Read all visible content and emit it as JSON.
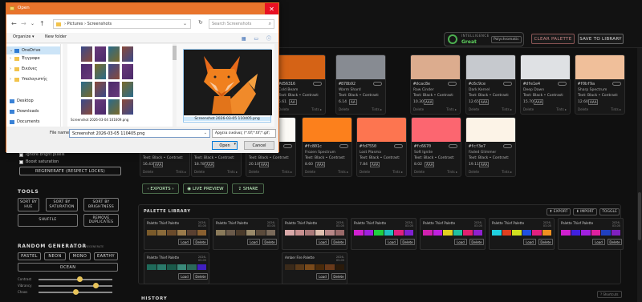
{
  "dialog": {
    "title": "Open",
    "close": "✕",
    "breadcrumb": "›  Pictures  ›  Screenshots",
    "search_placeholder": "Search Screenshots",
    "organize": "Organize ▾",
    "new_folder": "New folder",
    "nav_items": [
      {
        "label": "OneDrive",
        "color": "#2f7bd3"
      },
      {
        "label": "Έγγραφα",
        "color": "#f2c34c"
      },
      {
        "label": "Εικόνες",
        "color": "#f2c34c"
      },
      {
        "label": "Υπολογιστής",
        "color": "#f2c34c"
      },
      {
        "label": "Desktop",
        "color": "#3a82d6"
      },
      {
        "label": "Downloads",
        "color": "#3a82d6"
      },
      {
        "label": "Documents",
        "color": "#3a82d6"
      }
    ],
    "grid_files": [
      "Screenshot 2026-03-04 101609.png"
    ],
    "preview_caption": "Screenshot 2026-03-05 110405.png",
    "file_name_label": "File name:",
    "file_name_value": "Screenshot 2026-03-05 110405.png",
    "file_type": "Αρχεία εικόνας (*.tif;*.tif;*.gif;",
    "open": "Open",
    "cancel": "Cancel"
  },
  "header": {
    "intelligence_label": "INTELLIGENCE",
    "intelligence_value": "Great",
    "intelligence_chip": "Polychromatic",
    "clear_palette": "CLEAR PALETTE",
    "save_to_library": "SAVE TO LIBRARY"
  },
  "swatches": [
    {
      "hex": "#d56316",
      "color": "#d56316",
      "name": "Cold Beam",
      "contrast": "Text: Black • Contrast:",
      "ratio": "5.61",
      "aa": "AA"
    },
    {
      "hex": "#878b92",
      "color": "#878b92",
      "name": "Warm Shard",
      "contrast": "Text: Black • Contrast:",
      "ratio": "6.14",
      "aa": "AA"
    },
    {
      "hex": "#dcac8e",
      "color": "#dcac8e",
      "name": "Raw Cinder",
      "contrast": "Text: Black • Contrast:",
      "ratio": "10.30",
      "aa": "AAA"
    },
    {
      "hex": "#c6c9ce",
      "color": "#c6c9ce",
      "name": "Dark Kernel",
      "contrast": "Text: Black • Contrast:",
      "ratio": "12.65",
      "aa": "AAA"
    },
    {
      "hex": "#dfe1e4",
      "color": "#dfe1e4",
      "name": "Deep Dawn",
      "contrast": "Text: Black • Contrast:",
      "ratio": "15.70",
      "aa": "AAA"
    },
    {
      "hex": "#f0bf9a",
      "color": "#f0bf9a",
      "name": "Sharp Spectrum",
      "contrast": "Text: Black • Contrast:",
      "ratio": "12.60",
      "aa": "AAA"
    },
    {
      "hex": "",
      "color": "#fdf6ee",
      "name": "",
      "contrast": "Text: Black • Contrast:",
      "ratio": "16.43",
      "aa": "AAA"
    },
    {
      "hex": "",
      "color": "#ffffff",
      "name": "",
      "contrast": "Text: Black • Contrast:",
      "ratio": "18.78",
      "aa": "AAA"
    },
    {
      "hex": "",
      "color": "#fcfaf6",
      "name": "",
      "contrast": "Text: Black • Contrast:",
      "ratio": "20.10",
      "aa": "AAA"
    },
    {
      "hex": "#fc801c",
      "color": "#fc801c",
      "name": "Frozen Spectrum",
      "contrast": "Text: Black • Contrast:",
      "ratio": "8.60",
      "aa": "AAA"
    },
    {
      "hex": "#fd7550",
      "color": "#fd7550",
      "name": "Lost Plasma",
      "contrast": "Text: Black • Contrast:",
      "ratio": "7.84",
      "aa": "AAA"
    },
    {
      "hex": "#fc6670",
      "color": "#fc6670",
      "name": "Soft Ignite",
      "contrast": "Text: Black • Contrast:",
      "ratio": "8.02",
      "aa": "AAA"
    },
    {
      "hex": "#fcf3e7",
      "color": "#fcf3e7",
      "name": "Faded Glimmer",
      "contrast": "Text: Black • Contrast:",
      "ratio": "19.11",
      "aa": "AAA"
    }
  ],
  "swatch_delete": "Delete",
  "swatch_tints": "Tints ▸",
  "actions": {
    "exports": "‹ EXPORTS ›",
    "live_preview": "◉ LIVE PREVIEW",
    "share": "⇪ SHARE"
  },
  "library": {
    "title": "PALETTE LIBRARY",
    "export": "⬆ EXPORT",
    "import": "⬇ IMPORT",
    "toggle": "TOGGLE",
    "load": "Load",
    "delete": "Delete",
    "cards": [
      {
        "name": "Palette Thief Palette",
        "date": "2026-03-05",
        "colors": [
          "#7a5a2a",
          "#8a6a3a",
          "#6a4a2a",
          "#9a7a4a",
          "#5a4030",
          "#8a6030"
        ]
      },
      {
        "name": "Palette Thief Palette",
        "date": "2026-03-05",
        "colors": [
          "#8a7a5a",
          "#6a5a4a",
          "#4a3a2a",
          "#9a8a6a",
          "#5a4a3a",
          "#7a6a5a"
        ]
      },
      {
        "name": "Palette Thief Palette",
        "date": "2026-03-05",
        "colors": [
          "#d8a8a8",
          "#c89090",
          "#ab7a7a",
          "#e0c0b0",
          "#b88888",
          "#9a6a6a"
        ]
      },
      {
        "name": "Palette Thief Palette",
        "date": "2026-03-05",
        "colors": [
          "#d020d0",
          "#a020e0",
          "#20d040",
          "#20c0c0",
          "#e02080",
          "#8020d0"
        ]
      },
      {
        "name": "Palette Thief Palette",
        "date": "2026-03-05",
        "colors": [
          "#d020b0",
          "#c020e0",
          "#e0d020",
          "#20c0a0",
          "#e02070",
          "#9020d0"
        ]
      },
      {
        "name": "Palette Thief Palette",
        "date": "2026-03-05",
        "colors": [
          "#20d0e0",
          "#e04020",
          "#d0e020",
          "#2050e0",
          "#e02080",
          "#f09020"
        ]
      },
      {
        "name": "Palette Thief Palette",
        "date": "2026-03-05",
        "colors": [
          "#d020d0",
          "#4020e0",
          "#a020e0",
          "#e020a0",
          "#2040c0",
          "#8020c0"
        ]
      },
      {
        "name": "Palette Thief Palette",
        "date": "2026-03-05",
        "colors": [
          "#1f6a5a",
          "#2a7a6a",
          "#1a5a4a",
          "#3a8a7a",
          "#2a6a5a",
          "#4020c0"
        ]
      },
      {
        "name": "Amber Fire Palette",
        "date": "2026-03-05",
        "colors": [
          "#3a2a1a",
          "#5a3a1a",
          "#7a4a1a",
          "#4a2a0a",
          "#6a3a1a",
          "#2a1a0a"
        ]
      }
    ]
  },
  "history": "HISTORY",
  "shortcuts": "? Shortcuts",
  "sidebar": {
    "ignore_bright": "Ignore bright pixels",
    "boost_saturation": "Boost saturation",
    "regenerate": "REGENERATE (RESPECT LOCKS)",
    "tools_title": "TOOLS",
    "tools": [
      "SORT BY HUE",
      "SORT BY SATURATION",
      "SORT BY BRIGHTNESS",
      "SHUFFLE",
      "REMOVE DUPLICATES"
    ],
    "random_title": "RANDOM GENERATOR",
    "random_sub": "SPACE TO REGENERATE",
    "random_modes": [
      "PASTEL",
      "NEON",
      "MONO",
      "EARTHY",
      "OCEAN"
    ],
    "sliders": [
      {
        "label": "Contrast",
        "value": 0.56
      },
      {
        "label": "Vibrancy",
        "value": 0.78
      },
      {
        "label": "Chaos",
        "value": 0.5
      }
    ]
  }
}
